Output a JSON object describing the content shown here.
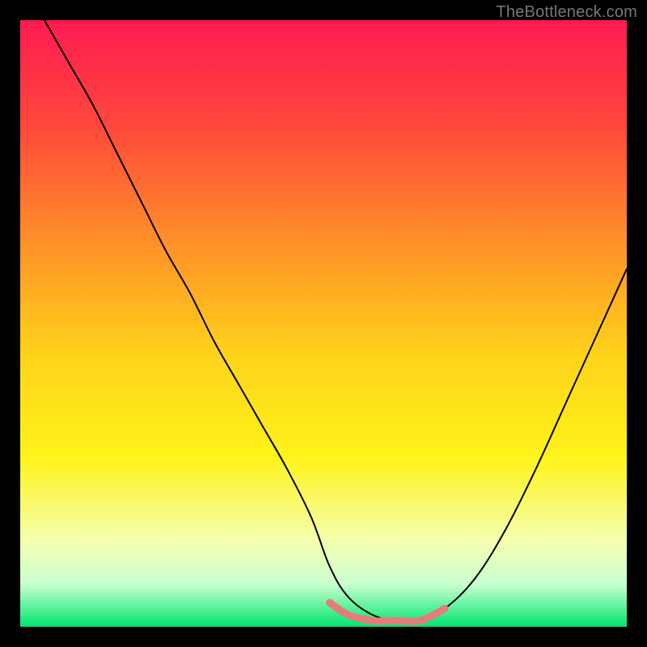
{
  "watermark": "TheBottleneck.com",
  "chart_data": {
    "type": "line",
    "title": "",
    "xlabel": "",
    "ylabel": "",
    "xlim": [
      0,
      100
    ],
    "ylim": [
      0,
      100
    ],
    "background_gradient": {
      "stops": [
        {
          "offset": 0.0,
          "color": "#ff1a52"
        },
        {
          "offset": 0.18,
          "color": "#ff4a3a"
        },
        {
          "offset": 0.35,
          "color": "#ff8a2a"
        },
        {
          "offset": 0.55,
          "color": "#ffd21a"
        },
        {
          "offset": 0.72,
          "color": "#fff31a"
        },
        {
          "offset": 0.86,
          "color": "#f5ffb0"
        },
        {
          "offset": 0.93,
          "color": "#c8ffd0"
        },
        {
          "offset": 1.0,
          "color": "#00e56e"
        }
      ]
    },
    "series": [
      {
        "name": "bottleneck-curve",
        "color": "#000000",
        "width": 2,
        "x": [
          4,
          8,
          12,
          16,
          20,
          24,
          28,
          32,
          36,
          40,
          44,
          48,
          51,
          54,
          58,
          62,
          66,
          70,
          75,
          80,
          85,
          90,
          95,
          100
        ],
        "y": [
          100,
          93,
          86,
          78,
          70,
          62,
          55,
          47,
          40,
          33,
          26,
          18,
          10,
          5,
          2,
          1,
          1,
          3,
          8,
          16,
          26,
          37,
          48,
          59
        ]
      },
      {
        "name": "highlight-band",
        "color": "#e77b7b",
        "width": 9,
        "x": [
          51,
          54,
          58,
          62,
          66,
          70
        ],
        "y": [
          4,
          2,
          1,
          1,
          1,
          3
        ]
      }
    ]
  }
}
